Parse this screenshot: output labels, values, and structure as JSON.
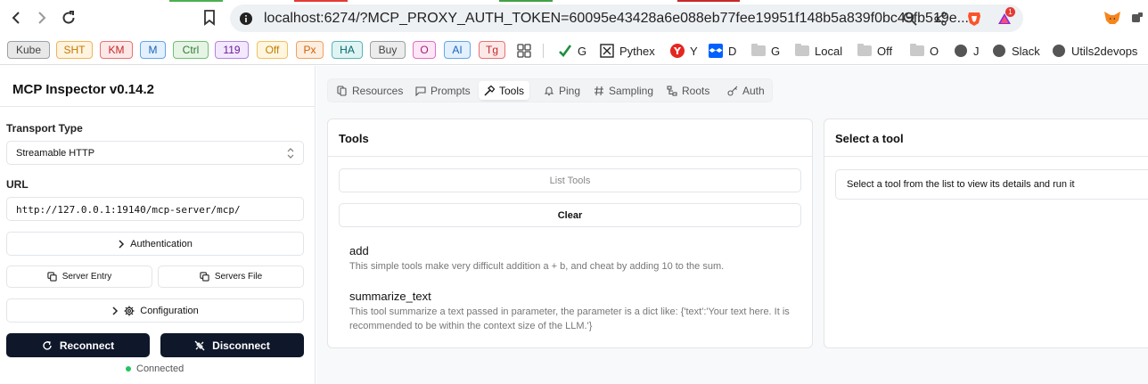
{
  "browser": {
    "url": "localhost:6274/?MCP_PROXY_AUTH_TOKEN=60095e43428a6e088eb77fee19951f148b5a839f0bc49fb519e...",
    "brave_badge": "1",
    "bookmark_chips": [
      {
        "label": "Kube",
        "bg": "#e8e8e8",
        "border": "#9aa0a6",
        "color": "#444"
      },
      {
        "label": "SHT",
        "bg": "#fff4e0",
        "border": "#f0b35a",
        "color": "#c77800"
      },
      {
        "label": "KM",
        "bg": "#fde8e8",
        "border": "#e57373",
        "color": "#c62828"
      },
      {
        "label": "M",
        "bg": "#e3f0fd",
        "border": "#64a5e8",
        "color": "#1565c0"
      },
      {
        "label": "Ctrl",
        "bg": "#e6f4e6",
        "border": "#6fbf73",
        "color": "#2e7d32"
      },
      {
        "label": "119",
        "bg": "#f3e8fd",
        "border": "#b085e0",
        "color": "#6a1b9a"
      },
      {
        "label": "Off",
        "bg": "#fff6e0",
        "border": "#f0c060",
        "color": "#c08000"
      },
      {
        "label": "Px",
        "bg": "#fdeee0",
        "border": "#f0a060",
        "color": "#d06000"
      },
      {
        "label": "HA",
        "bg": "#e0f4f4",
        "border": "#5bb5b5",
        "color": "#00696b"
      },
      {
        "label": "Buy",
        "bg": "#ececec",
        "border": "#9aa0a6",
        "color": "#444"
      },
      {
        "label": "O",
        "bg": "#fde6f5",
        "border": "#e070c0",
        "color": "#a0207a"
      },
      {
        "label": "AI",
        "bg": "#e3f0fd",
        "border": "#64a5e8",
        "color": "#1565c0"
      },
      {
        "label": "Tg",
        "bg": "#fde8e8",
        "border": "#e57373",
        "color": "#c62828"
      }
    ],
    "bookmarks": [
      "G",
      "Pythex",
      "Y",
      "D",
      "G",
      "Local",
      "Off",
      "O",
      "J",
      "Slack",
      "Utils2devops"
    ]
  },
  "sidebar": {
    "title": "MCP Inspector v0.14.2",
    "transport_label": "Transport Type",
    "transport_value": "Streamable HTTP",
    "url_label": "URL",
    "url_value": "http://127.0.0.1:19140/mcp-server/mcp/",
    "authentication": "Authentication",
    "server_entry": "Server Entry",
    "servers_file": "Servers File",
    "configuration": "Configuration",
    "reconnect": "Reconnect",
    "disconnect": "Disconnect",
    "status": "Connected",
    "status_color": "#22c55e"
  },
  "tabs": [
    {
      "label": "Resources",
      "icon": "files-icon"
    },
    {
      "label": "Prompts",
      "icon": "message-icon"
    },
    {
      "label": "Tools",
      "icon": "hammer-icon",
      "active": true
    },
    {
      "label": "Ping",
      "icon": "bell-icon"
    },
    {
      "label": "Sampling",
      "icon": "hash-icon"
    },
    {
      "label": "Roots",
      "icon": "tree-icon"
    },
    {
      "label": "Auth",
      "icon": "key-icon"
    }
  ],
  "tools_panel": {
    "title": "Tools",
    "list_tools": "List Tools",
    "clear": "Clear",
    "tools": [
      {
        "name": "add",
        "description": "This simple tools make very difficult addition a + b, and cheat by adding 10 to the sum."
      },
      {
        "name": "summarize_text",
        "description": "This tool summarize a text passed in parameter, the parameter is a dict like: {'text':'Your text here. It is recommended to be within the context size of the LLM.'}"
      }
    ]
  },
  "details_panel": {
    "title": "Select a tool",
    "message": "Select a tool from the list to view its details and run it"
  }
}
